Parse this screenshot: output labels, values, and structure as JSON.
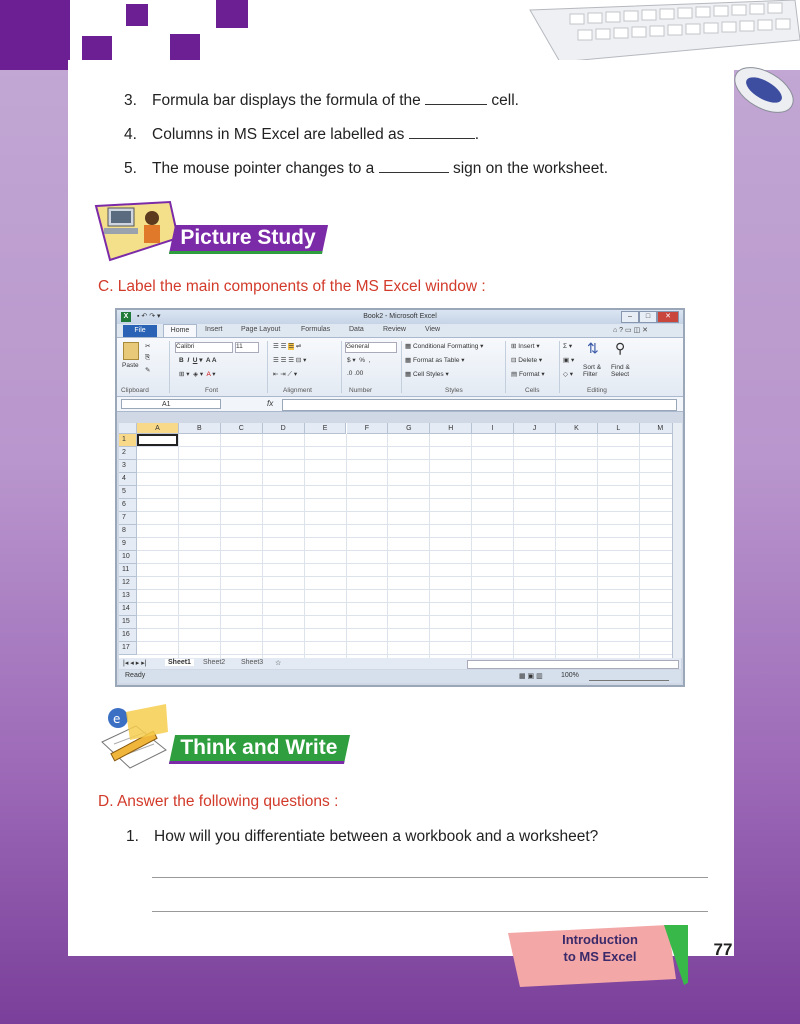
{
  "fill_questions": [
    {
      "num": "3.",
      "before": "Formula bar displays the formula of the",
      "after": "cell."
    },
    {
      "num": "4.",
      "before": "Columns in MS Excel are labelled as",
      "after": "."
    },
    {
      "num": "5.",
      "before": "The mouse pointer changes to a",
      "after": "sign on the worksheet."
    }
  ],
  "picture_study": {
    "banner": "Picture Study",
    "instruction": "C.  Label the main components of the MS Excel window :"
  },
  "excel": {
    "title": "Book2 - Microsoft Excel",
    "tabs": [
      "File",
      "Home",
      "Insert",
      "Page Layout",
      "Formulas",
      "Data",
      "Review",
      "View"
    ],
    "font_name": "Calibri",
    "font_size": "11",
    "number_format": "General",
    "styles": [
      "Conditional Formatting",
      "Format as Table",
      "Cell Styles"
    ],
    "cells_cmds": [
      "Insert",
      "Delete",
      "Format"
    ],
    "editing": [
      "Sort &",
      "Filter",
      "Find &",
      "Select"
    ],
    "paste": "Paste",
    "groups": [
      "Clipboard",
      "Font",
      "Alignment",
      "Number",
      "Styles",
      "Cells",
      "Editing"
    ],
    "name_box": "A1",
    "fx": "fx",
    "columns": [
      "A",
      "B",
      "C",
      "D",
      "E",
      "F",
      "G",
      "H",
      "I",
      "J",
      "K",
      "L",
      "M"
    ],
    "rows": [
      "1",
      "2",
      "3",
      "4",
      "5",
      "6",
      "7",
      "8",
      "9",
      "10",
      "11",
      "12",
      "13",
      "14",
      "15",
      "16",
      "17"
    ],
    "sheets": [
      "Sheet1",
      "Sheet2",
      "Sheet3"
    ],
    "status": "Ready",
    "zoom": "100%"
  },
  "think_write": {
    "banner": "Think and Write",
    "instruction": "D.  Answer the following questions :",
    "question": {
      "num": "1.",
      "text": "How will you differentiate between a workbook and a worksheet?"
    }
  },
  "footer": {
    "line1": "Introduction",
    "line2": "to MS Excel",
    "page": "77"
  },
  "colors": {
    "purple": "#6b1f93",
    "section_red": "#d23a2a",
    "banner_purple": "#7b2aa8",
    "banner_green": "#2e9e3e"
  }
}
